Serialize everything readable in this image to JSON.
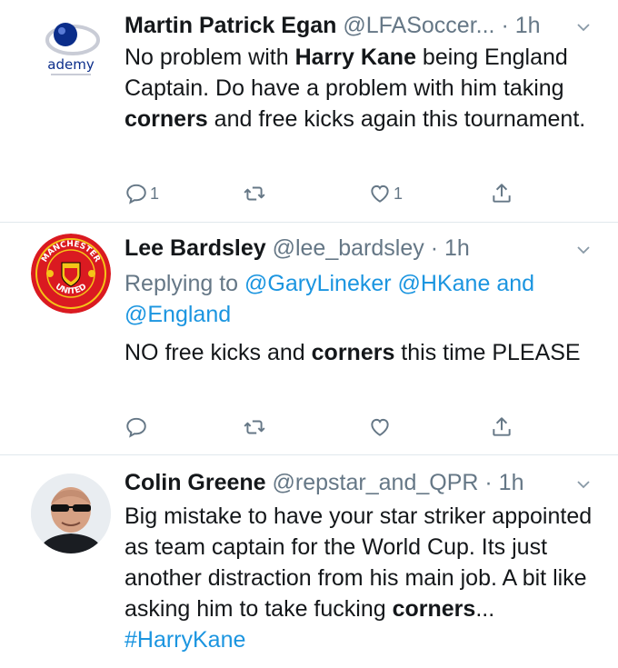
{
  "tweets": [
    {
      "name": "Martin Patrick Egan",
      "handle": "@LFASoccer...",
      "time": "· 1h",
      "avatar_icon": "academy-logo-icon",
      "avatar_text": "ademy",
      "body_segments": [
        {
          "text": "No problem with ",
          "style": "normal"
        },
        {
          "text": "Harry Kane",
          "style": "bold"
        },
        {
          "text": " being England Captain. Do have a problem with him taking ",
          "style": "normal"
        },
        {
          "text": "corners",
          "style": "bold"
        },
        {
          "text": " and free kicks again this tournament.",
          "style": "normal"
        }
      ],
      "reply_count": "1",
      "retweet_count": "",
      "like_count": "1"
    },
    {
      "name": "Lee Bardsley",
      "handle": "@lee_bardsley",
      "time": "· 1h",
      "avatar_icon": "manchester-united-crest-icon",
      "avatar_text_top": "MANCHESTER",
      "avatar_text_bottom": "UNITED",
      "replying_label": "Replying to",
      "replying_mentions": [
        "@GaryLineker",
        "@HKane",
        "@England"
      ],
      "replying_and": "and",
      "body_segments": [
        {
          "text": "NO free kicks and ",
          "style": "normal"
        },
        {
          "text": "corners",
          "style": "bold"
        },
        {
          "text": " this time PLEASE",
          "style": "normal"
        }
      ],
      "reply_count": "",
      "retweet_count": "",
      "like_count": ""
    },
    {
      "name": "Colin Greene",
      "handle": "@repstar_and_QPR",
      "time": "· 1h",
      "avatar_icon": "user-photo-icon",
      "body_segments": [
        {
          "text": "Big mistake to have your star striker appointed as team captain for the World Cup. Its just another distraction from his main job. A bit like asking him to take fucking ",
          "style": "normal"
        },
        {
          "text": "corners",
          "style": "bold"
        },
        {
          "text": "... ",
          "style": "normal"
        },
        {
          "text": "#HarryKane",
          "style": "hashtag"
        }
      ]
    }
  ],
  "colors": {
    "text": "#14171a",
    "secondary": "#657786",
    "link": "#1b95e0",
    "divider": "#e1e8ed"
  }
}
